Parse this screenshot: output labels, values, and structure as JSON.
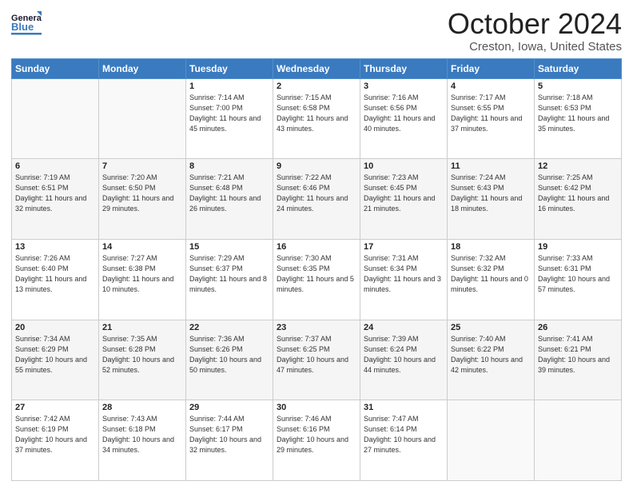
{
  "header": {
    "logo_line1": "General",
    "logo_line2": "Blue",
    "title": "October 2024",
    "subtitle": "Creston, Iowa, United States"
  },
  "weekdays": [
    "Sunday",
    "Monday",
    "Tuesday",
    "Wednesday",
    "Thursday",
    "Friday",
    "Saturday"
  ],
  "weeks": [
    [
      {
        "day": "",
        "info": ""
      },
      {
        "day": "",
        "info": ""
      },
      {
        "day": "1",
        "info": "Sunrise: 7:14 AM\nSunset: 7:00 PM\nDaylight: 11 hours and 45 minutes."
      },
      {
        "day": "2",
        "info": "Sunrise: 7:15 AM\nSunset: 6:58 PM\nDaylight: 11 hours and 43 minutes."
      },
      {
        "day": "3",
        "info": "Sunrise: 7:16 AM\nSunset: 6:56 PM\nDaylight: 11 hours and 40 minutes."
      },
      {
        "day": "4",
        "info": "Sunrise: 7:17 AM\nSunset: 6:55 PM\nDaylight: 11 hours and 37 minutes."
      },
      {
        "day": "5",
        "info": "Sunrise: 7:18 AM\nSunset: 6:53 PM\nDaylight: 11 hours and 35 minutes."
      }
    ],
    [
      {
        "day": "6",
        "info": "Sunrise: 7:19 AM\nSunset: 6:51 PM\nDaylight: 11 hours and 32 minutes."
      },
      {
        "day": "7",
        "info": "Sunrise: 7:20 AM\nSunset: 6:50 PM\nDaylight: 11 hours and 29 minutes."
      },
      {
        "day": "8",
        "info": "Sunrise: 7:21 AM\nSunset: 6:48 PM\nDaylight: 11 hours and 26 minutes."
      },
      {
        "day": "9",
        "info": "Sunrise: 7:22 AM\nSunset: 6:46 PM\nDaylight: 11 hours and 24 minutes."
      },
      {
        "day": "10",
        "info": "Sunrise: 7:23 AM\nSunset: 6:45 PM\nDaylight: 11 hours and 21 minutes."
      },
      {
        "day": "11",
        "info": "Sunrise: 7:24 AM\nSunset: 6:43 PM\nDaylight: 11 hours and 18 minutes."
      },
      {
        "day": "12",
        "info": "Sunrise: 7:25 AM\nSunset: 6:42 PM\nDaylight: 11 hours and 16 minutes."
      }
    ],
    [
      {
        "day": "13",
        "info": "Sunrise: 7:26 AM\nSunset: 6:40 PM\nDaylight: 11 hours and 13 minutes."
      },
      {
        "day": "14",
        "info": "Sunrise: 7:27 AM\nSunset: 6:38 PM\nDaylight: 11 hours and 10 minutes."
      },
      {
        "day": "15",
        "info": "Sunrise: 7:29 AM\nSunset: 6:37 PM\nDaylight: 11 hours and 8 minutes."
      },
      {
        "day": "16",
        "info": "Sunrise: 7:30 AM\nSunset: 6:35 PM\nDaylight: 11 hours and 5 minutes."
      },
      {
        "day": "17",
        "info": "Sunrise: 7:31 AM\nSunset: 6:34 PM\nDaylight: 11 hours and 3 minutes."
      },
      {
        "day": "18",
        "info": "Sunrise: 7:32 AM\nSunset: 6:32 PM\nDaylight: 11 hours and 0 minutes."
      },
      {
        "day": "19",
        "info": "Sunrise: 7:33 AM\nSunset: 6:31 PM\nDaylight: 10 hours and 57 minutes."
      }
    ],
    [
      {
        "day": "20",
        "info": "Sunrise: 7:34 AM\nSunset: 6:29 PM\nDaylight: 10 hours and 55 minutes."
      },
      {
        "day": "21",
        "info": "Sunrise: 7:35 AM\nSunset: 6:28 PM\nDaylight: 10 hours and 52 minutes."
      },
      {
        "day": "22",
        "info": "Sunrise: 7:36 AM\nSunset: 6:26 PM\nDaylight: 10 hours and 50 minutes."
      },
      {
        "day": "23",
        "info": "Sunrise: 7:37 AM\nSunset: 6:25 PM\nDaylight: 10 hours and 47 minutes."
      },
      {
        "day": "24",
        "info": "Sunrise: 7:39 AM\nSunset: 6:24 PM\nDaylight: 10 hours and 44 minutes."
      },
      {
        "day": "25",
        "info": "Sunrise: 7:40 AM\nSunset: 6:22 PM\nDaylight: 10 hours and 42 minutes."
      },
      {
        "day": "26",
        "info": "Sunrise: 7:41 AM\nSunset: 6:21 PM\nDaylight: 10 hours and 39 minutes."
      }
    ],
    [
      {
        "day": "27",
        "info": "Sunrise: 7:42 AM\nSunset: 6:19 PM\nDaylight: 10 hours and 37 minutes."
      },
      {
        "day": "28",
        "info": "Sunrise: 7:43 AM\nSunset: 6:18 PM\nDaylight: 10 hours and 34 minutes."
      },
      {
        "day": "29",
        "info": "Sunrise: 7:44 AM\nSunset: 6:17 PM\nDaylight: 10 hours and 32 minutes."
      },
      {
        "day": "30",
        "info": "Sunrise: 7:46 AM\nSunset: 6:16 PM\nDaylight: 10 hours and 29 minutes."
      },
      {
        "day": "31",
        "info": "Sunrise: 7:47 AM\nSunset: 6:14 PM\nDaylight: 10 hours and 27 minutes."
      },
      {
        "day": "",
        "info": ""
      },
      {
        "day": "",
        "info": ""
      }
    ]
  ]
}
